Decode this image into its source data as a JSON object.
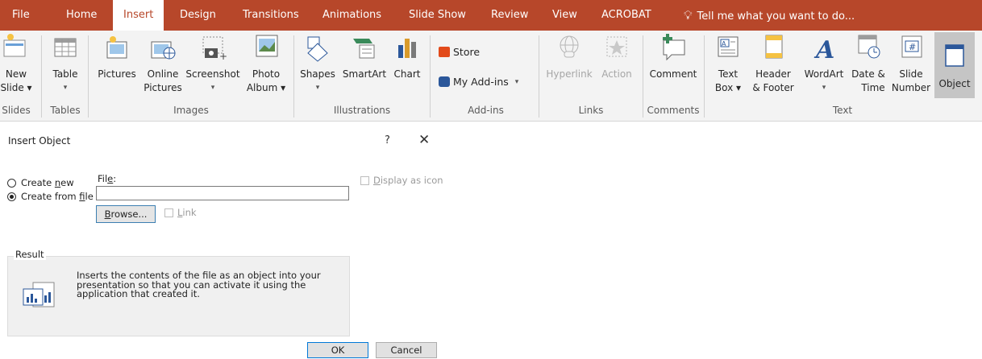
{
  "tabs": [
    "File",
    "Home",
    "Insert",
    "Design",
    "Transitions",
    "Animations",
    "Slide Show",
    "Review",
    "View",
    "ACROBAT"
  ],
  "active_tab": "Insert",
  "tell_me": "Tell me what you want to do...",
  "ribbon": {
    "new_slide": [
      "New",
      "Slide ▾"
    ],
    "table": [
      "Table",
      "▾"
    ],
    "pictures": "Pictures",
    "online_pictures": [
      "Online",
      "Pictures"
    ],
    "screenshot": [
      "Screenshot",
      "▾"
    ],
    "photo_album": [
      "Photo",
      "Album ▾"
    ],
    "shapes": [
      "Shapes",
      "▾"
    ],
    "smartart": "SmartArt",
    "chart": "Chart",
    "store": "Store",
    "my_addins": "My Add-ins",
    "hyperlink": "Hyperlink",
    "action": "Action",
    "comment": "Comment",
    "text_box": [
      "Text",
      "Box ▾"
    ],
    "header_footer": [
      "Header",
      "& Footer"
    ],
    "wordart": [
      "WordArt",
      "▾"
    ],
    "date_time": [
      "Date &",
      "Time"
    ],
    "slide_number": [
      "Slide",
      "Number"
    ],
    "object": "Object",
    "groups": {
      "slides": "Slides",
      "tables": "Tables",
      "images": "Images",
      "illustrations": "Illustrations",
      "addins": "Add-ins",
      "links": "Links",
      "comments": "Comments",
      "text": "Text"
    }
  },
  "dialog": {
    "title": "Insert Object",
    "help": "?",
    "close": "✕",
    "create_new": "Create new",
    "create_from_file": "Create from file",
    "selected_option": "create_from_file",
    "file_label": "File:",
    "file_value": "",
    "browse": "Browse...",
    "link": "Link",
    "display_as_icon": "Display as icon",
    "result_label": "Result",
    "result_text": "Inserts the contents of the file as an object into your presentation so that you can activate it using the application that created it.",
    "ok": "OK",
    "cancel": "Cancel"
  },
  "colors": {
    "brand": "#b7472a",
    "ribbon_bg": "#f3f3f3",
    "accent_blue": "#2b579a"
  }
}
